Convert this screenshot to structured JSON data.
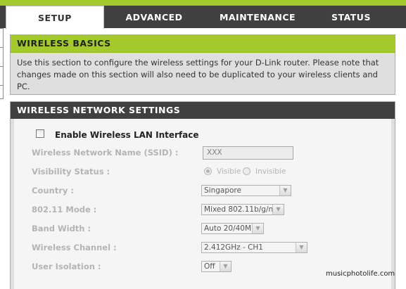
{
  "tabs": [
    "SETUP",
    "ADVANCED",
    "MAINTENANCE",
    "STATUS"
  ],
  "wireless_basics": {
    "title": "WIRELESS BASICS",
    "text_line1": "Use this section to configure the wireless settings for your D-Link router. Please note that",
    "text_line2": "changes made on this section will also need to be duplicated to your wireless clients and PC."
  },
  "network_settings": {
    "title": "WIRELESS NETWORK SETTINGS",
    "enable_label": "Enable Wireless LAN Interface",
    "enable_checked": false,
    "ssid_label": "Wireless Network Name (SSID) :",
    "ssid_value": "XXX",
    "visibility_label": "Visibility Status :",
    "visibility_options": [
      "Visible",
      "Invisible"
    ],
    "visibility_selected": "Visible",
    "country_label": "Country :",
    "country_value": "Singapore",
    "mode_label": "802.11 Mode :",
    "mode_value": "Mixed 802.11b/g/n",
    "bandwidth_label": "Band Width :",
    "bandwidth_value": "Auto 20/40M",
    "channel_label": "Wireless Channel :",
    "channel_value": "2.412GHz - CH1",
    "isolation_label": "User Isolation :",
    "isolation_value": "Off"
  },
  "watermark": "musicphotolife.com",
  "colors": {
    "accent_green": "#a3c92d",
    "header_dark": "#404040"
  }
}
